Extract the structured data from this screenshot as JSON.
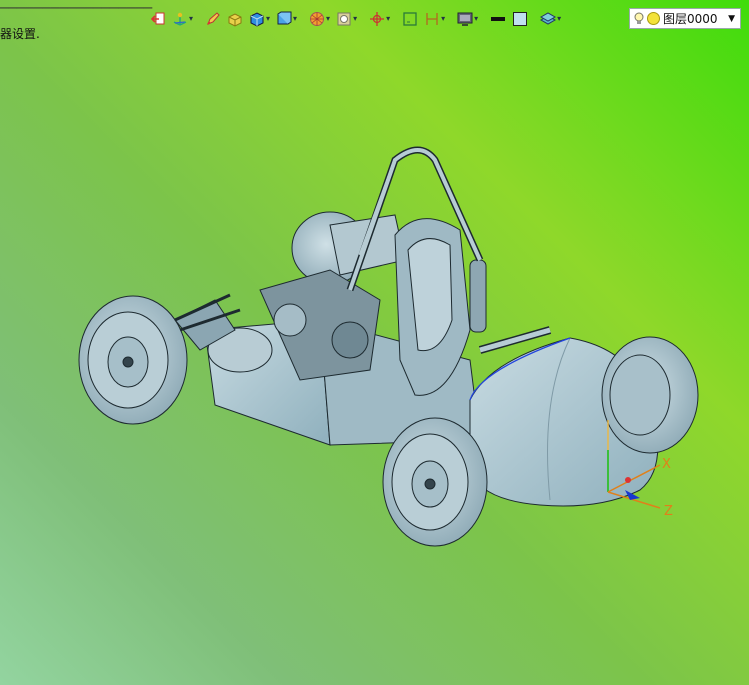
{
  "status": {
    "text": "器设置."
  },
  "toolbar": {
    "buttons": [
      {
        "icon": "exit-sketch-icon"
      },
      {
        "icon": "wcs-icon",
        "dropdown": true
      },
      {
        "icon": "pencil-icon"
      },
      {
        "icon": "yellow-box-icon"
      },
      {
        "icon": "blue-cube-icon",
        "dropdown": true
      },
      {
        "icon": "view-cube-icon",
        "dropdown": true
      },
      {
        "icon": "wireframe-ball-icon",
        "dropdown": true
      },
      {
        "icon": "section-view-icon",
        "dropdown": true
      },
      {
        "icon": "snap-point-icon",
        "dropdown": true
      },
      {
        "icon": "frame-icon"
      },
      {
        "icon": "dimension-icon",
        "dropdown": true
      },
      {
        "icon": "monitor-icon",
        "dropdown": true
      },
      {
        "icon": "line-color-icon"
      },
      {
        "icon": "fill-color-icon"
      },
      {
        "icon": "layer-icon",
        "dropdown": true
      }
    ]
  },
  "layer": {
    "value": "图层0000"
  },
  "axes": {
    "x": "X",
    "z": "Z"
  },
  "colors": {
    "background_top": "#3fdc0c",
    "background_bottom": "#93d4a0",
    "model": "#a9c2cc",
    "model_edge": "#1d2a30"
  }
}
